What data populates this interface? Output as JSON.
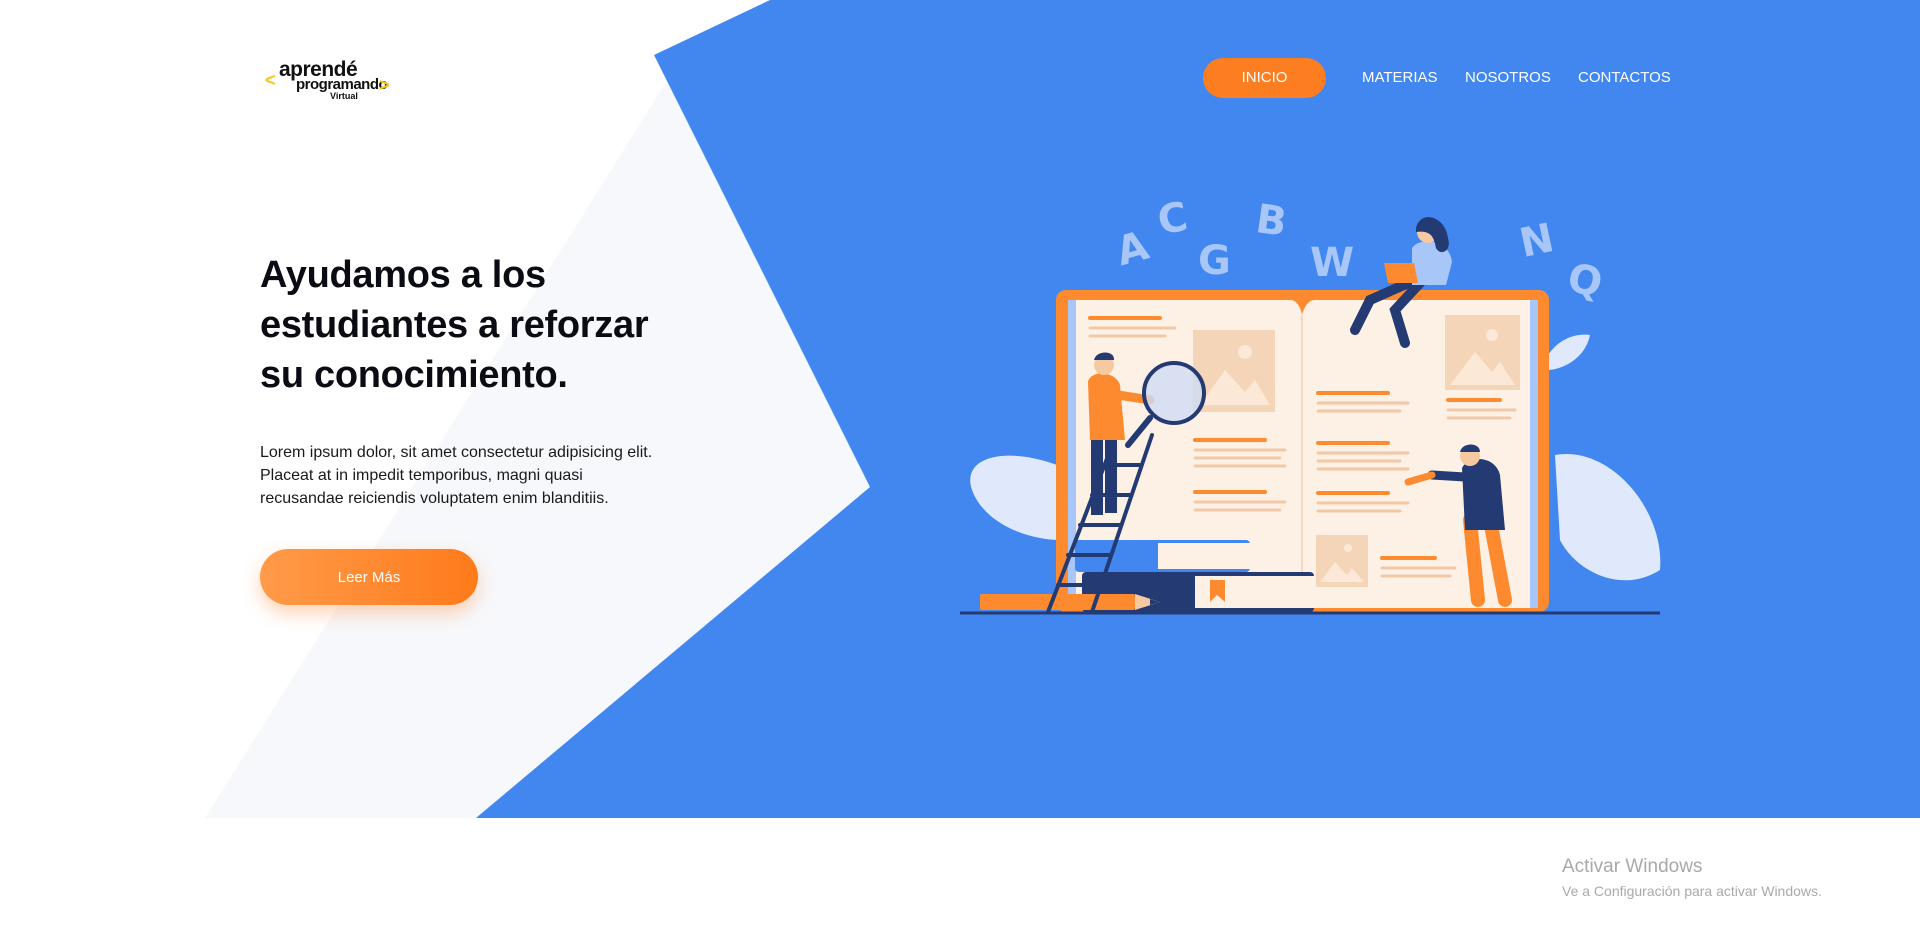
{
  "logo": {
    "line1": "aprendé",
    "line2": "programando",
    "line3": "Virtual",
    "bracket_left": "<",
    "bracket_right": ">",
    "icon": "logo"
  },
  "nav": {
    "items": [
      {
        "label": "INICIO",
        "active": true
      },
      {
        "label": "MATERIAS"
      },
      {
        "label": "NOSOTROS"
      },
      {
        "label": "CONTACTOS"
      }
    ]
  },
  "hero": {
    "title": "Ayudamos a los estudiantes a reforzar su conocimiento.",
    "text": "Lorem ipsum dolor, sit amet consectetur adipisicing elit. Placeat at in impedit temporibus, magni quasi recusandae reiciendis voluptatem enim blanditiis.",
    "cta_label": "Leer Más"
  },
  "illustration": {
    "letters": [
      "A",
      "C",
      "G",
      "B",
      "W",
      "N",
      "Q"
    ],
    "icon": "open-book-study-illustration"
  },
  "watermark": {
    "title": "Activar Windows",
    "subtitle": "Ve a Configuración para activar Windows."
  },
  "colors": {
    "primary_blue": "#4287ef",
    "accent_orange": "#fd7e20",
    "light_shape": "#f7f8fb"
  }
}
